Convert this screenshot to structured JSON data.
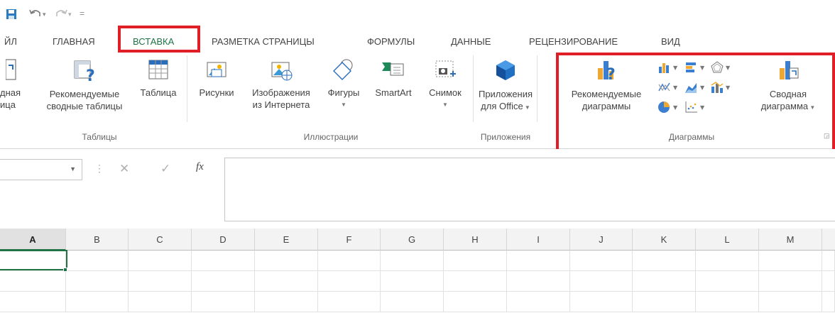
{
  "tabs": [
    {
      "label": "ЙЛ"
    },
    {
      "label": "ГЛАВНАЯ"
    },
    {
      "label": "ВСТАВКА"
    },
    {
      "label": "РАЗМЕТКА СТРАНИЦЫ"
    },
    {
      "label": "ФОРМУЛЫ"
    },
    {
      "label": "ДАННЫЕ"
    },
    {
      "label": "РЕЦЕНЗИРОВАНИЕ"
    },
    {
      "label": "ВИД"
    }
  ],
  "qat": {
    "customize": "="
  },
  "ribbon": {
    "tables": {
      "pivot_line1": "дная",
      "pivot_line2": "ица",
      "recommended_pivot_line1": "Рекомендуемые",
      "recommended_pivot_line2": "сводные таблицы",
      "table": "Таблица",
      "group": "Таблицы"
    },
    "illustrations": {
      "pictures": "Рисунки",
      "online_line1": "Изображения",
      "online_line2": "из Интернета",
      "shapes": "Фигуры",
      "smartart": "SmartArt",
      "screenshot": "Снимок",
      "group": "Иллюстрации"
    },
    "apps": {
      "line1": "Приложения",
      "line2": "для Office",
      "group": "Приложения"
    },
    "charts": {
      "recommended_line1": "Рекомендуемые",
      "recommended_line2": "диаграммы",
      "pivot_line1": "Сводная",
      "pivot_line2": "диаграмма",
      "group": "Диаграммы"
    }
  },
  "formula_bar": {
    "fx": "fx",
    "cancel": "✕",
    "enter": "✓",
    "formula": ""
  },
  "columns": [
    "A",
    "B",
    "C",
    "D",
    "E",
    "F",
    "G",
    "H",
    "I",
    "J",
    "K",
    "L",
    "M"
  ],
  "colors": {
    "accent": "#217346",
    "highlight": "#e01e26"
  }
}
